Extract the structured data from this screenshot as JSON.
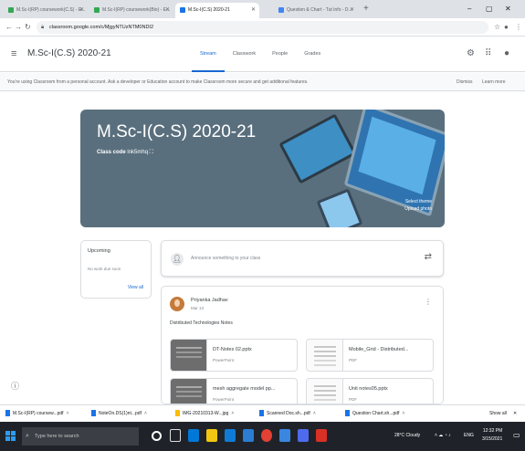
{
  "browser": {
    "tabs": [
      {
        "label": "M.Sc-I(RP) coursework(C.S) - E...",
        "color": "#34a853",
        "active": false
      },
      {
        "label": "M.Sc-I(RP) coursework(Bio) - E...",
        "color": "#34a853",
        "active": false
      },
      {
        "label": "M.Sc-I(C.S) 2020-21",
        "color": "#1a73e8",
        "active": true
      },
      {
        "label": "Question & Chart - Tut Info - D...",
        "color": "#4285f4",
        "active": false
      }
    ],
    "url": "classroom.google.com/c/MjgyNTUzNTM0NDI2",
    "window_controls": [
      "–",
      "▢",
      "✕"
    ]
  },
  "header": {
    "course_name": "M.Sc-I(C.S) 2020-21",
    "tabs": [
      {
        "label": "Stream",
        "active": true
      },
      {
        "label": "Classwork",
        "active": false
      },
      {
        "label": "People",
        "active": false
      },
      {
        "label": "Grades",
        "active": false
      }
    ]
  },
  "info_banner": {
    "text": "You're using Classroom from a personal account. Ask a developer or Education account to make Classroom more secure and get additional features.",
    "dismiss_label": "Dismiss",
    "learn_more_label": "Learn more"
  },
  "banner": {
    "title": "M.Sc-I(C.S) 2020-21",
    "class_code_label": "Class code",
    "class_code_value": "lnk5mhq",
    "select_theme_label": "Select theme",
    "upload_photo_label": "Upload photo",
    "bg_color": "#5a6f7d"
  },
  "upcoming": {
    "title": "Upcoming",
    "status": "No work due soon",
    "view_all_label": "View all"
  },
  "announce": {
    "placeholder": "Announce something to your class"
  },
  "post": {
    "author": "Priyanka Jadhav",
    "date": "Mar 13",
    "description": "Distributed Technologies Notes",
    "attachments": [
      {
        "name": "DT-Notes 02.pptx",
        "kind": "PowerPoint",
        "thumb": "dark"
      },
      {
        "name": "Mobile_Grid - Distributed...",
        "kind": "PDF",
        "thumb": "doc"
      },
      {
        "name": "mesh aggregate model pp...",
        "kind": "PowerPoint",
        "thumb": "dark"
      },
      {
        "name": "Unit notes05.pptx",
        "kind": "PDF",
        "thumb": "doc"
      }
    ]
  },
  "downloads": {
    "items": [
      "M.Sc-I(RP) coursew...pdf",
      "NoteOn.DS(1)nt...pdf",
      "IMG-20210313-W...jpg",
      "Scanned Doc.sh...pdf",
      "Question Chart.sh...pdf"
    ],
    "show_all_label": "Show all"
  },
  "taskbar": {
    "search_placeholder": "Type here to search",
    "weather": "28°C Cloudy",
    "language": "ENG",
    "time": "12:32 PM",
    "date": "3/15/2021"
  }
}
